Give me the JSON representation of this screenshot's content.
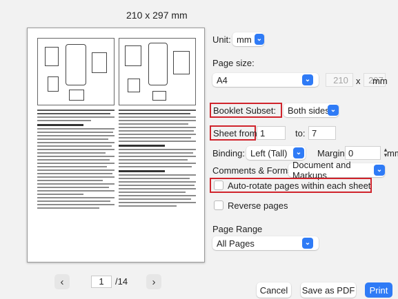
{
  "preview": {
    "paper_size": "210 x 297 mm",
    "current_page": "1",
    "total_pages": "/14",
    "prev_icon": "‹",
    "next_icon": "›"
  },
  "settings": {
    "unit_label": "Unit:",
    "unit_value": "mm",
    "page_size_label": "Page size:",
    "page_size_value": "A4",
    "width_value": "210",
    "size_separator": "x",
    "height_value": "297",
    "size_unit": "mm",
    "booklet_subset_label": "Booklet Subset:",
    "booklet_subset_value": "Both sides",
    "sheet_from_label": "Sheet from:",
    "sheet_from_value": "1",
    "sheet_to_label": "to:",
    "sheet_to_value": "7",
    "binding_label": "Binding:",
    "binding_value": "Left (Tall)",
    "margin_label": "Margin:",
    "margin_value": "0",
    "margin_unit": "mm",
    "comments_forms_label": "Comments & Forms:",
    "comments_forms_value": "Document and Markups",
    "auto_rotate_label": "Auto-rotate pages within each sheet",
    "reverse_pages_label": "Reverse pages",
    "page_range_label": "Page Range",
    "page_range_value": "All Pages"
  },
  "buttons": {
    "cancel": "Cancel",
    "save_pdf": "Save as PDF",
    "print": "Print"
  },
  "colors": {
    "accent": "#2f7bf6",
    "highlight": "#d0232b"
  }
}
